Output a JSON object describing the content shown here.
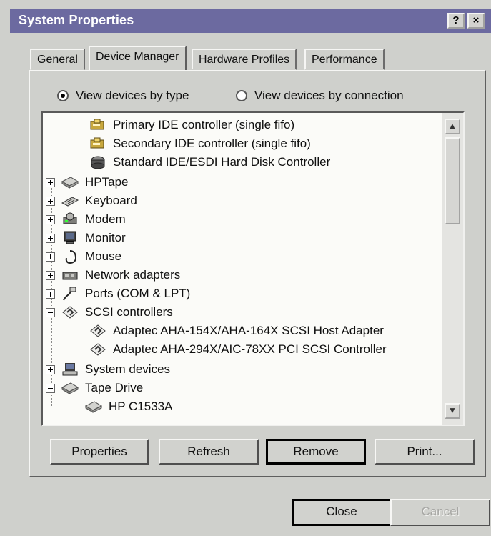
{
  "window": {
    "title": "System Properties",
    "help_label": "?",
    "close_label": "×"
  },
  "tabs": [
    {
      "label": "General"
    },
    {
      "label": "Device Manager"
    },
    {
      "label": "Hardware Profiles"
    },
    {
      "label": "Performance"
    }
  ],
  "view_options": {
    "by_type": "View devices by type",
    "by_connection": "View devices by connection"
  },
  "tree": {
    "items": [
      {
        "label": "Primary IDE controller (single fifo)"
      },
      {
        "label": "Secondary IDE controller (single fifo)"
      },
      {
        "label": "Standard IDE/ESDI Hard Disk Controller"
      },
      {
        "label": "HPTape"
      },
      {
        "label": "Keyboard"
      },
      {
        "label": "Modem"
      },
      {
        "label": "Monitor"
      },
      {
        "label": "Mouse"
      },
      {
        "label": "Network adapters"
      },
      {
        "label": "Ports (COM & LPT)"
      },
      {
        "label": "SCSI controllers"
      },
      {
        "label": "Adaptec AHA-154X/AHA-164X SCSI Host Adapter"
      },
      {
        "label": "Adaptec AHA-294X/AIC-78XX PCI SCSI Controller"
      },
      {
        "label": "System devices"
      },
      {
        "label": "Tape Drive"
      },
      {
        "label": "HP C1533A"
      }
    ]
  },
  "buttons": {
    "properties": "Properties",
    "refresh": "Refresh",
    "remove": "Remove",
    "print": "Print...",
    "close": "Close",
    "cancel": "Cancel"
  },
  "colors": {
    "titlebar": "#6c6aa0",
    "dialog_bg": "#cfd0cc",
    "tree_bg": "#fbfbf8"
  }
}
